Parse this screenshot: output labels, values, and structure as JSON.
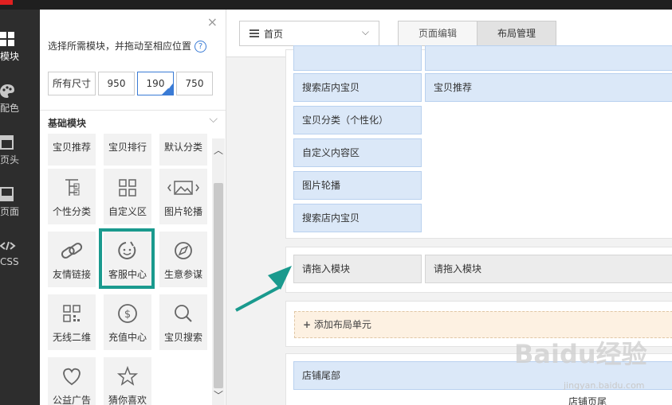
{
  "rail": {
    "items": [
      {
        "label": "模块",
        "icon": "grid-icon"
      },
      {
        "label": "配色",
        "icon": "palette-icon"
      },
      {
        "label": "页头",
        "icon": "header-icon"
      },
      {
        "label": "页面",
        "icon": "page-icon"
      },
      {
        "label": "CSS",
        "icon": "code-icon"
      }
    ]
  },
  "panel": {
    "hint": "选择所需模块，并拖动至相应位置",
    "help_icon": "?",
    "close_icon": "×",
    "sizes": [
      "所有尺寸",
      "950",
      "190",
      "750"
    ],
    "selected_size": "190",
    "section_title": "基础模块",
    "tiles": [
      {
        "label": "宝贝推荐",
        "icon": "none"
      },
      {
        "label": "宝贝排行",
        "icon": "none"
      },
      {
        "label": "默认分类",
        "icon": "none"
      },
      {
        "label": "个性分类",
        "icon": "tree-icon"
      },
      {
        "label": "自定义区",
        "icon": "grid-icon"
      },
      {
        "label": "图片轮播",
        "icon": "image-carousel-icon"
      },
      {
        "label": "友情链接",
        "icon": "link-icon"
      },
      {
        "label": "客服中心",
        "icon": "smile-icon"
      },
      {
        "label": "生意参谋",
        "icon": "compass-icon"
      },
      {
        "label": "无线二维",
        "icon": "qrcode-icon"
      },
      {
        "label": "充值中心",
        "icon": "dollar-icon"
      },
      {
        "label": "宝贝搜索",
        "icon": "search-icon"
      },
      {
        "label": "公益广告",
        "icon": "heart-icon"
      },
      {
        "label": "猜你喜欢",
        "icon": "star-icon"
      }
    ]
  },
  "toolbar": {
    "page_select": "首页",
    "tabs": [
      "页面编辑",
      "布局管理"
    ],
    "active_tab": "布局管理"
  },
  "layout": {
    "top_right_partial": "宝贝推荐",
    "left_modules": [
      "搜索店内宝贝",
      "宝贝分类（个性化）",
      "自定义内容区",
      "图片轮播",
      "搜索店内宝贝"
    ],
    "right_module": "宝贝推荐",
    "drop_left": "请拖入模块",
    "drop_right": "请拖入模块",
    "add_unit": "添加布局单元",
    "footer_module": "店铺尾部",
    "footer_label": "店铺页尾"
  },
  "watermark": {
    "brand": "Baidu经验",
    "sub": "jingyan.baidu.com"
  },
  "colors": {
    "accent": "#3a7bd5",
    "highlight": "#1a9a8e",
    "module_bg": "#dbe8f8",
    "add_unit_bg": "#fdf1e2"
  }
}
